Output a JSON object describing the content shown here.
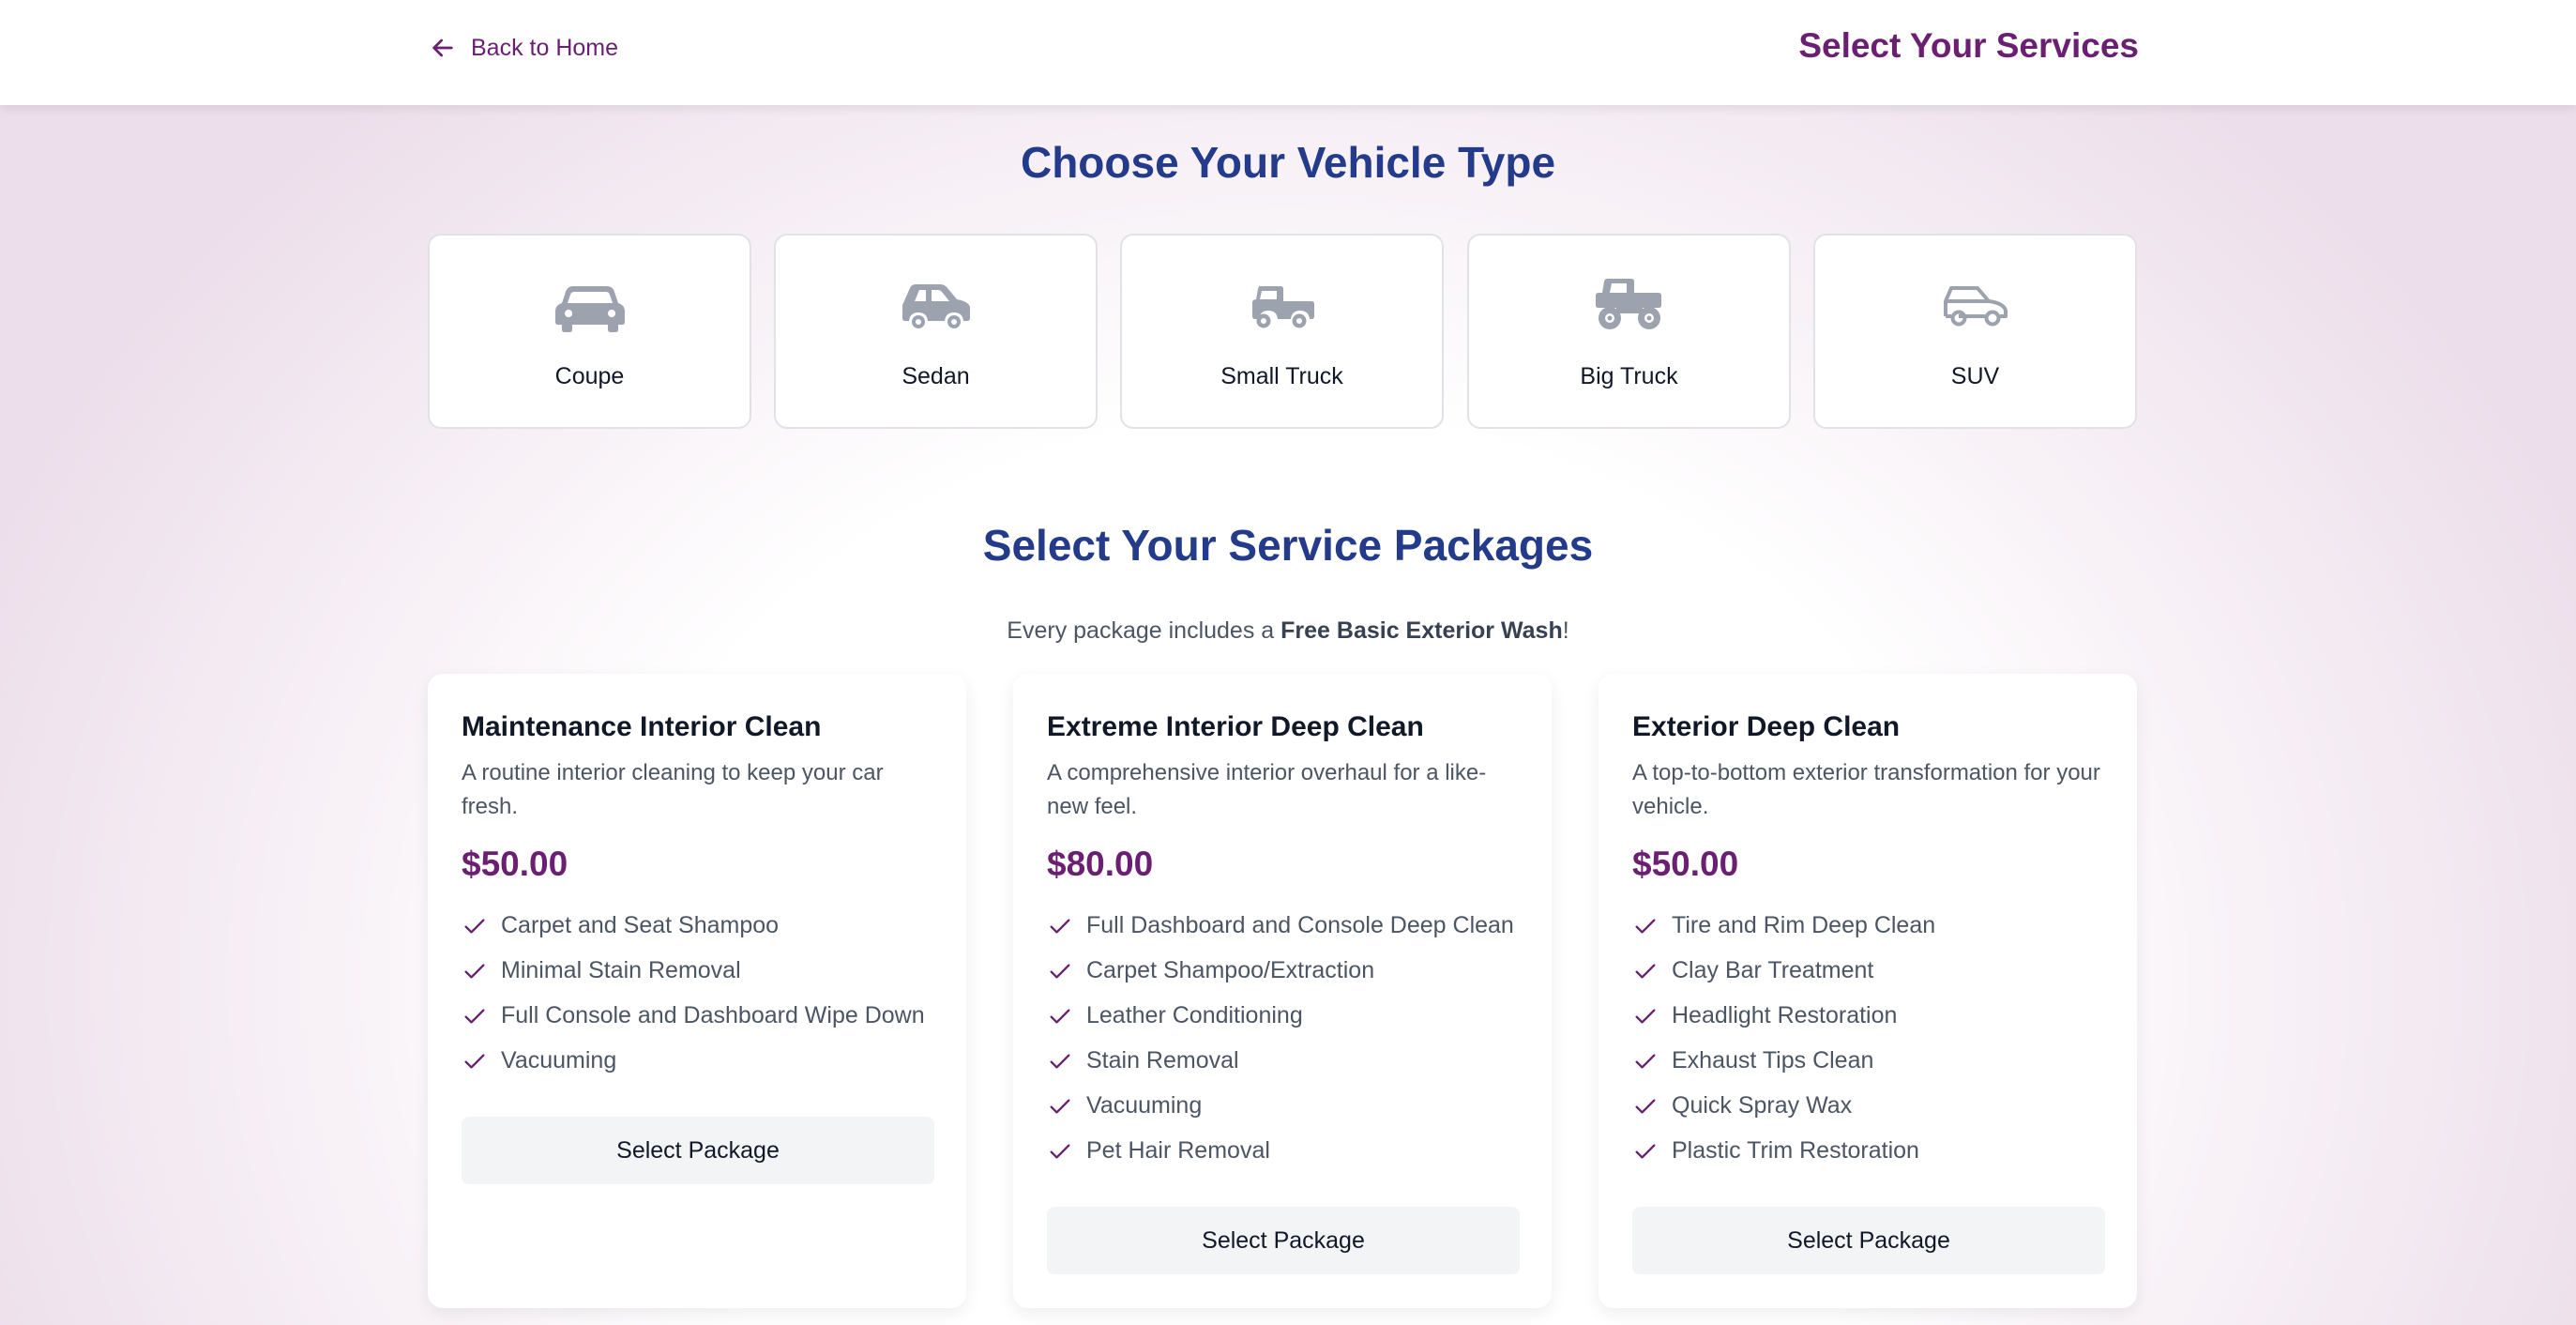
{
  "header": {
    "back_label": "Back to Home",
    "title": "Select Your Services"
  },
  "vehicles": {
    "title": "Choose Your Vehicle Type",
    "items": [
      {
        "label": "Coupe",
        "icon": "coupe-car-icon"
      },
      {
        "label": "Sedan",
        "icon": "sedan-car-icon"
      },
      {
        "label": "Small Truck",
        "icon": "small-truck-icon"
      },
      {
        "label": "Big Truck",
        "icon": "big-truck-icon"
      },
      {
        "label": "SUV",
        "icon": "suv-icon"
      }
    ]
  },
  "packages": {
    "title": "Select Your Service Packages",
    "subtitle_prefix": "Every package includes a ",
    "subtitle_bold": "Free Basic Exterior Wash",
    "subtitle_suffix": "!",
    "button_label": "Select Package",
    "items": [
      {
        "name": "Maintenance Interior Clean",
        "description": "A routine interior cleaning to keep your car fresh.",
        "price": "$50.00",
        "features": [
          "Carpet and Seat Shampoo",
          "Minimal Stain Removal",
          "Full Console and Dashboard Wipe Down",
          "Vacuuming"
        ]
      },
      {
        "name": "Extreme Interior Deep Clean",
        "description": "A comprehensive interior overhaul for a like-new feel.",
        "price": "$80.00",
        "features": [
          "Full Dashboard and Console Deep Clean",
          "Carpet Shampoo/Extraction",
          "Leather Conditioning",
          "Stain Removal",
          "Vacuuming",
          "Pet Hair Removal"
        ]
      },
      {
        "name": "Exterior Deep Clean",
        "description": "A top-to-bottom exterior transformation for your vehicle.",
        "price": "$50.00",
        "features": [
          "Tire and Rim Deep Clean",
          "Clay Bar Treatment",
          "Headlight Restoration",
          "Exhaust Tips Clean",
          "Quick Spray Wax",
          "Plastic Trim Restoration"
        ]
      }
    ]
  },
  "colors": {
    "brand_purple": "#6b1f73",
    "heading_blue": "#233b8a",
    "icon_gray": "#9ca3af"
  }
}
